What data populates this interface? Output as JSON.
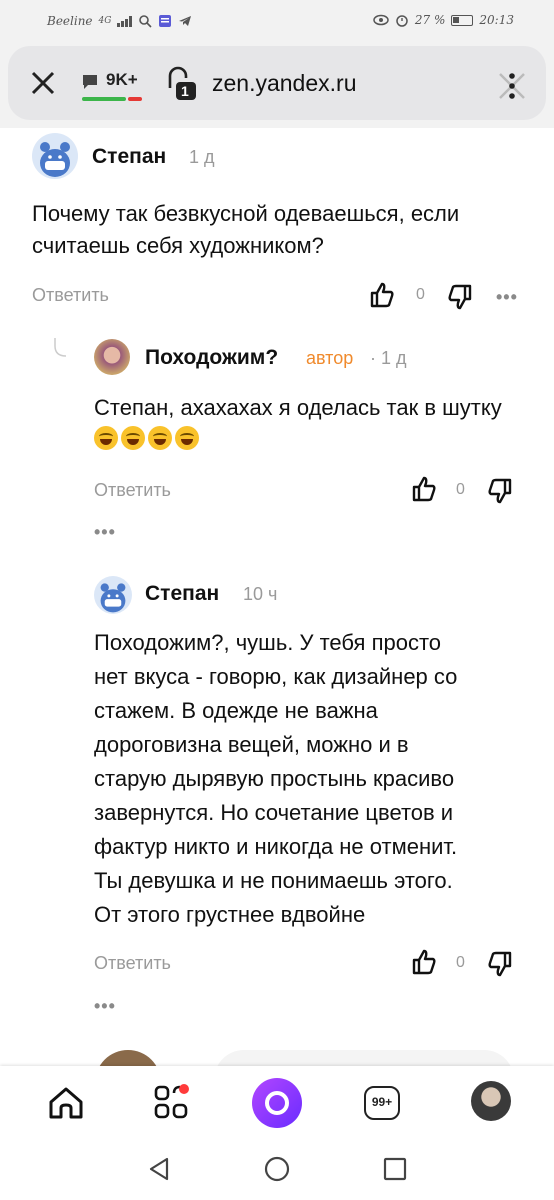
{
  "status_bar": {
    "carrier": "Beeline",
    "network": "4G",
    "battery": "27 %",
    "time": "20:13"
  },
  "browser": {
    "tabs_count": "9K+",
    "lock_badge": "1",
    "url": "zen.yandex.ru"
  },
  "comments": [
    {
      "author": "Степан",
      "age": "1 д",
      "text": "Почему так безвкусной одеваешься, если считаешь себя художником?",
      "reply_label": "Ответить",
      "likes": "0"
    },
    {
      "author": "Походожим?",
      "author_tag": "автор",
      "age": "· 1 д",
      "text": "Степан, ахахахах я оделась так в шутку",
      "reply_label": "Ответить",
      "likes": "0",
      "more": "•••"
    },
    {
      "author": "Степан",
      "age": "10 ч",
      "text_lines": [
        "Походожим?, чушь. У тебя просто",
        "нет вкуса - говорю, как дизайнер со",
        "стажем. В одежде не важна",
        "дороговизна вещей, можно и в",
        "старую дырявую простынь красиво",
        "завернутся. Но сочетание цветов и",
        "фактур никто и никогда не отменит.",
        "Ты девушка и не понимаешь этого.",
        "От этого грустнее вдвойне"
      ],
      "reply_label": "Ответить",
      "likes": "0",
      "more": "•••"
    }
  ],
  "top_more": "•••",
  "bottom_nav": {
    "badge": "99+"
  },
  "colors": {
    "accent_author": "#f08a2c",
    "alice_purple": "#8a3cff",
    "meta_gray": "#9a9a9a"
  }
}
